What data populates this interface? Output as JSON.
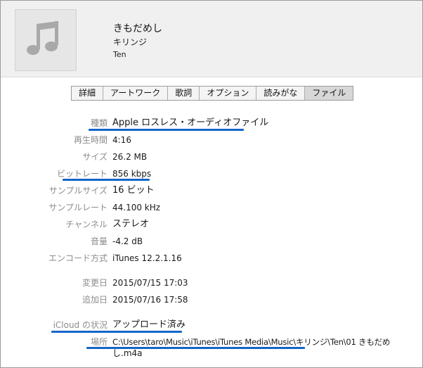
{
  "header": {
    "title": "きもだめし",
    "artist": "キリンジ",
    "album": "Ten",
    "artwork_icon": "music-note-icon"
  },
  "tabs": [
    {
      "label": "詳細",
      "active": false
    },
    {
      "label": "アートワーク",
      "active": false
    },
    {
      "label": "歌詞",
      "active": false
    },
    {
      "label": "オプション",
      "active": false
    },
    {
      "label": "読みがな",
      "active": false
    },
    {
      "label": "ファイル",
      "active": true
    }
  ],
  "file_info": {
    "kind_label": "種類",
    "kind_value": "Apple ロスレス・オーディオファイル",
    "duration_label": "再生時間",
    "duration_value": "4:16",
    "size_label": "サイズ",
    "size_value": "26.2 MB",
    "bitrate_label": "ビットレート",
    "bitrate_value": "856 kbps",
    "sample_size_label": "サンプルサイズ",
    "sample_size_value": "16 ビット",
    "sample_rate_label": "サンプルレート",
    "sample_rate_value": "44.100 kHz",
    "channels_label": "チャンネル",
    "channels_value": "ステレオ",
    "volume_label": "音量",
    "volume_value": "-4.2 dB",
    "encoder_label": "エンコード方式",
    "encoder_value": "iTunes 12.2.1.16",
    "modified_label": "変更日",
    "modified_value": "2015/07/15 17:03",
    "added_label": "追加日",
    "added_value": "2015/07/16 17:58",
    "icloud_label": "iCloud の状況",
    "icloud_value": "アップロード済み",
    "location_label": "場所",
    "location_value_line1": "C:\\Users\\taro\\Music\\iTunes\\iTunes Media\\Music\\キリンジ\\Ten\\01 きもだめ",
    "location_value_line2": "し.m4a"
  },
  "colors": {
    "underline": "#1565c9",
    "label_gray": "#8c8c8c",
    "header_bg": "#f0f0f0"
  }
}
